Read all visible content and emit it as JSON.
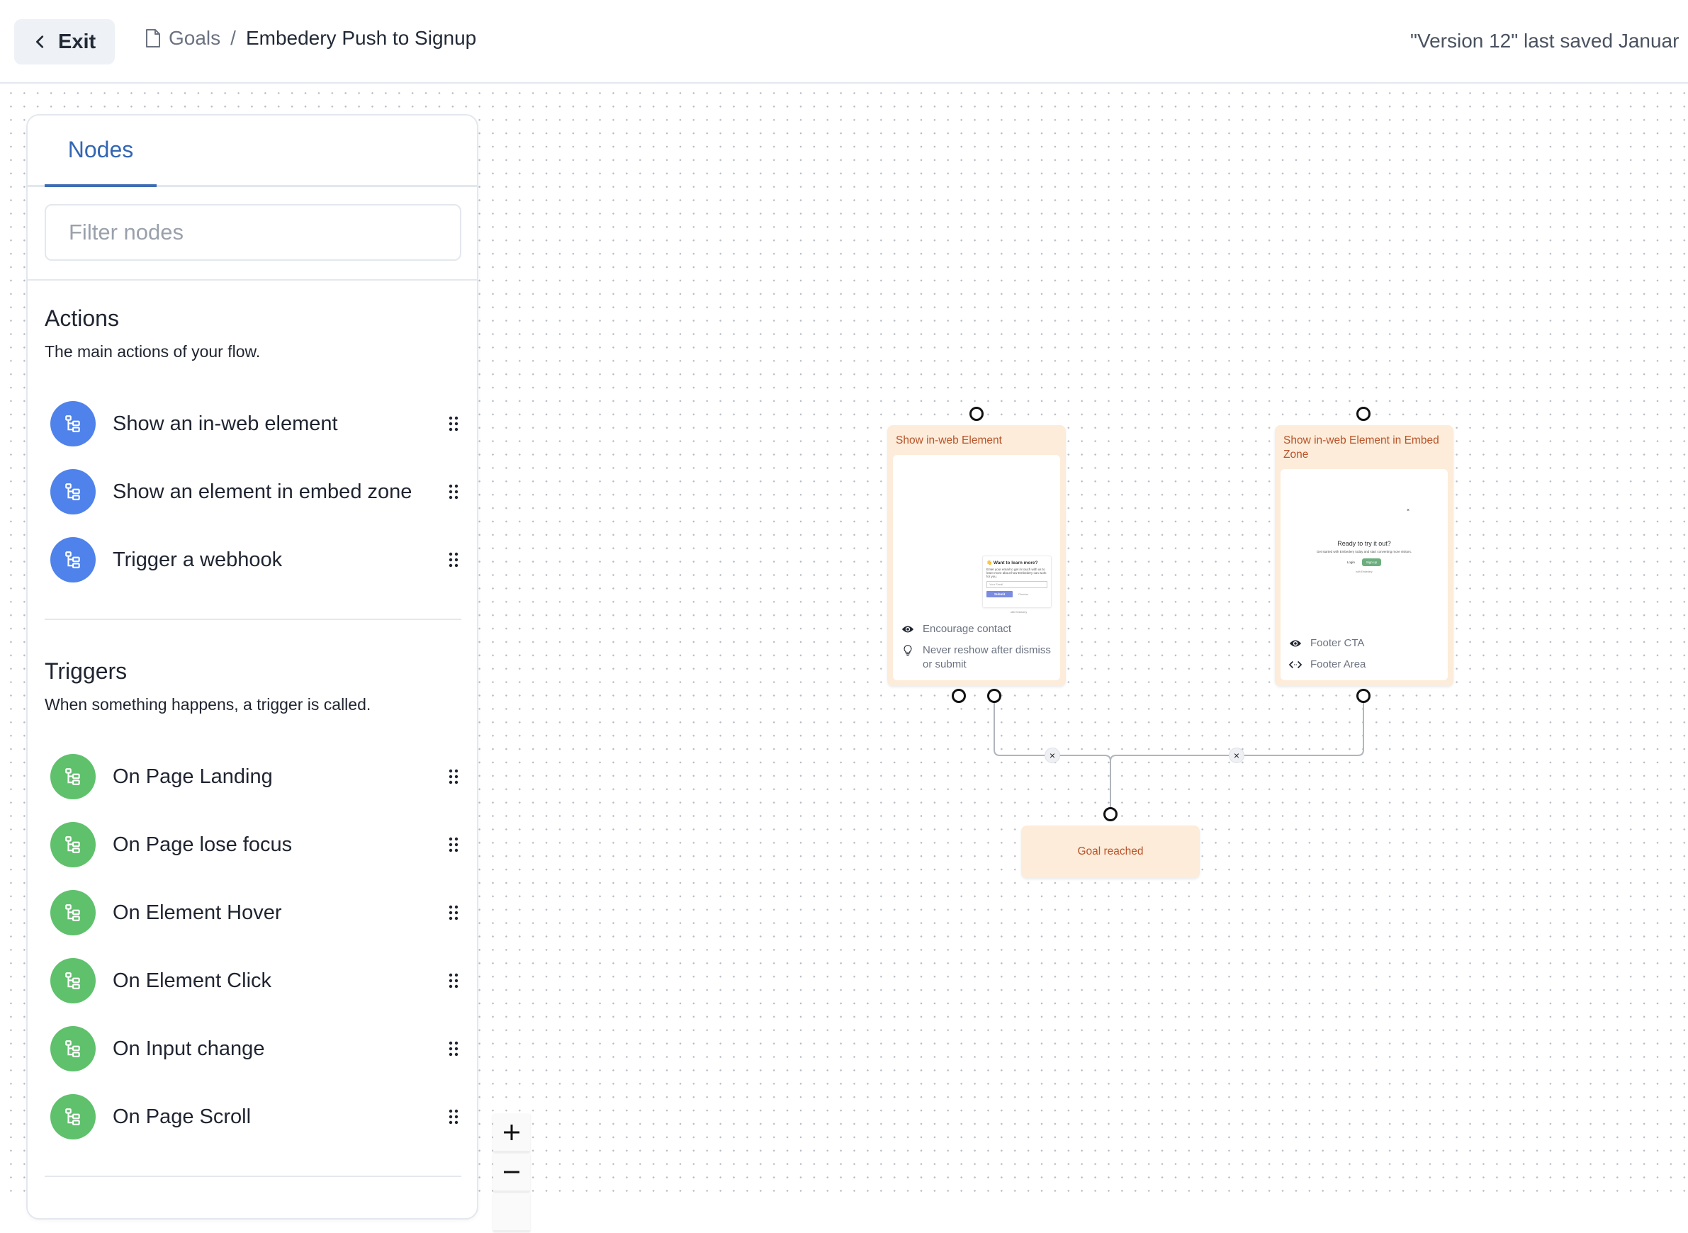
{
  "header": {
    "exit_label": "Exit",
    "breadcrumb": {
      "parent": "Goals",
      "separator": "/",
      "current": "Embedery Push to Signup"
    },
    "save_status": "\"Version 12\" last saved Januar"
  },
  "sidebar": {
    "tabs": [
      {
        "label": "Nodes",
        "active": true
      }
    ],
    "filter": {
      "placeholder": "Filter nodes",
      "value": ""
    },
    "sections": [
      {
        "title": "Actions",
        "description": "The main actions of your flow.",
        "color": "#4f82ea",
        "items": [
          {
            "label": "Show an in-web element",
            "icon": "hierarchy-icon"
          },
          {
            "label": "Show an element in embed zone",
            "icon": "hierarchy-icon"
          },
          {
            "label": "Trigger a webhook",
            "icon": "hierarchy-icon"
          }
        ]
      },
      {
        "title": "Triggers",
        "description": "When something happens, a trigger is called.",
        "color": "#5fc16c",
        "items": [
          {
            "label": "On Page Landing",
            "icon": "hierarchy-icon"
          },
          {
            "label": "On Page lose focus",
            "icon": "hierarchy-icon"
          },
          {
            "label": "On Element Hover",
            "icon": "hierarchy-icon"
          },
          {
            "label": "On Element Click",
            "icon": "hierarchy-icon"
          },
          {
            "label": "On Input change",
            "icon": "hierarchy-icon"
          },
          {
            "label": "On Page Scroll",
            "icon": "hierarchy-icon"
          }
        ]
      }
    ]
  },
  "flow": {
    "nodes": [
      {
        "title": "Show in-web Element",
        "preview": {
          "heading": "👋 Want to learn more?",
          "text": "Enter your email to get in touch with us to learn more about how Embedery can work for you.",
          "input_placeholder": "Your Email",
          "submit": "Submit",
          "dismiss": "Dismiss",
          "footer": "with Embedery"
        },
        "meta": [
          {
            "icon": "eye-icon",
            "text": "Encourage contact"
          },
          {
            "icon": "lightbulb-icon",
            "text": "Never reshow after dismiss or submit"
          }
        ]
      },
      {
        "title": "Show in-web Element in Embed Zone",
        "preview": {
          "close": "×",
          "heading": "Ready to try it out?",
          "text": "Get started with Embedery today and start converting more visitors.",
          "login": "Login",
          "signup": "Sign up",
          "footer": "with Embedery"
        },
        "meta": [
          {
            "icon": "eye-icon",
            "text": "Footer CTA"
          },
          {
            "icon": "code-arrows-icon",
            "text": "Footer Area"
          }
        ]
      },
      {
        "title": "Goal reached"
      }
    ],
    "edge_delete_label": "×"
  },
  "zoom_controls": {
    "zoom_in": "+",
    "zoom_out": "−"
  },
  "colors": {
    "accent": "#3e6db5",
    "action": "#4f82ea",
    "trigger": "#5fc16c",
    "node_bg": "#fcecd9",
    "node_title": "#b9532a"
  }
}
